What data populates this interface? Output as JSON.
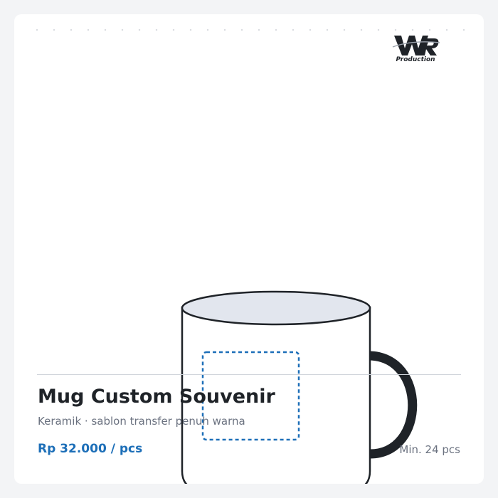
{
  "brand": {
    "logo_text_main": "WR",
    "logo_text_sub": "Production"
  },
  "product": {
    "title": "Mug Custom Souvenir",
    "subtitle": "Keramik · sablon transfer penuh warna",
    "price": "Rp 32.000 / pcs",
    "min_order": "Min. 24 pcs"
  },
  "colors": {
    "background": "#f3f4f6",
    "card": "#ffffff",
    "accent": "#1d6fb8",
    "title": "#1f2328",
    "muted": "#6b7280",
    "mug_outline": "#1f2328",
    "mug_rim": "#e2e6ee",
    "print_area": "#1d6fb8"
  },
  "icons": {
    "brand": "brand-logo",
    "product": "mug-icon"
  }
}
